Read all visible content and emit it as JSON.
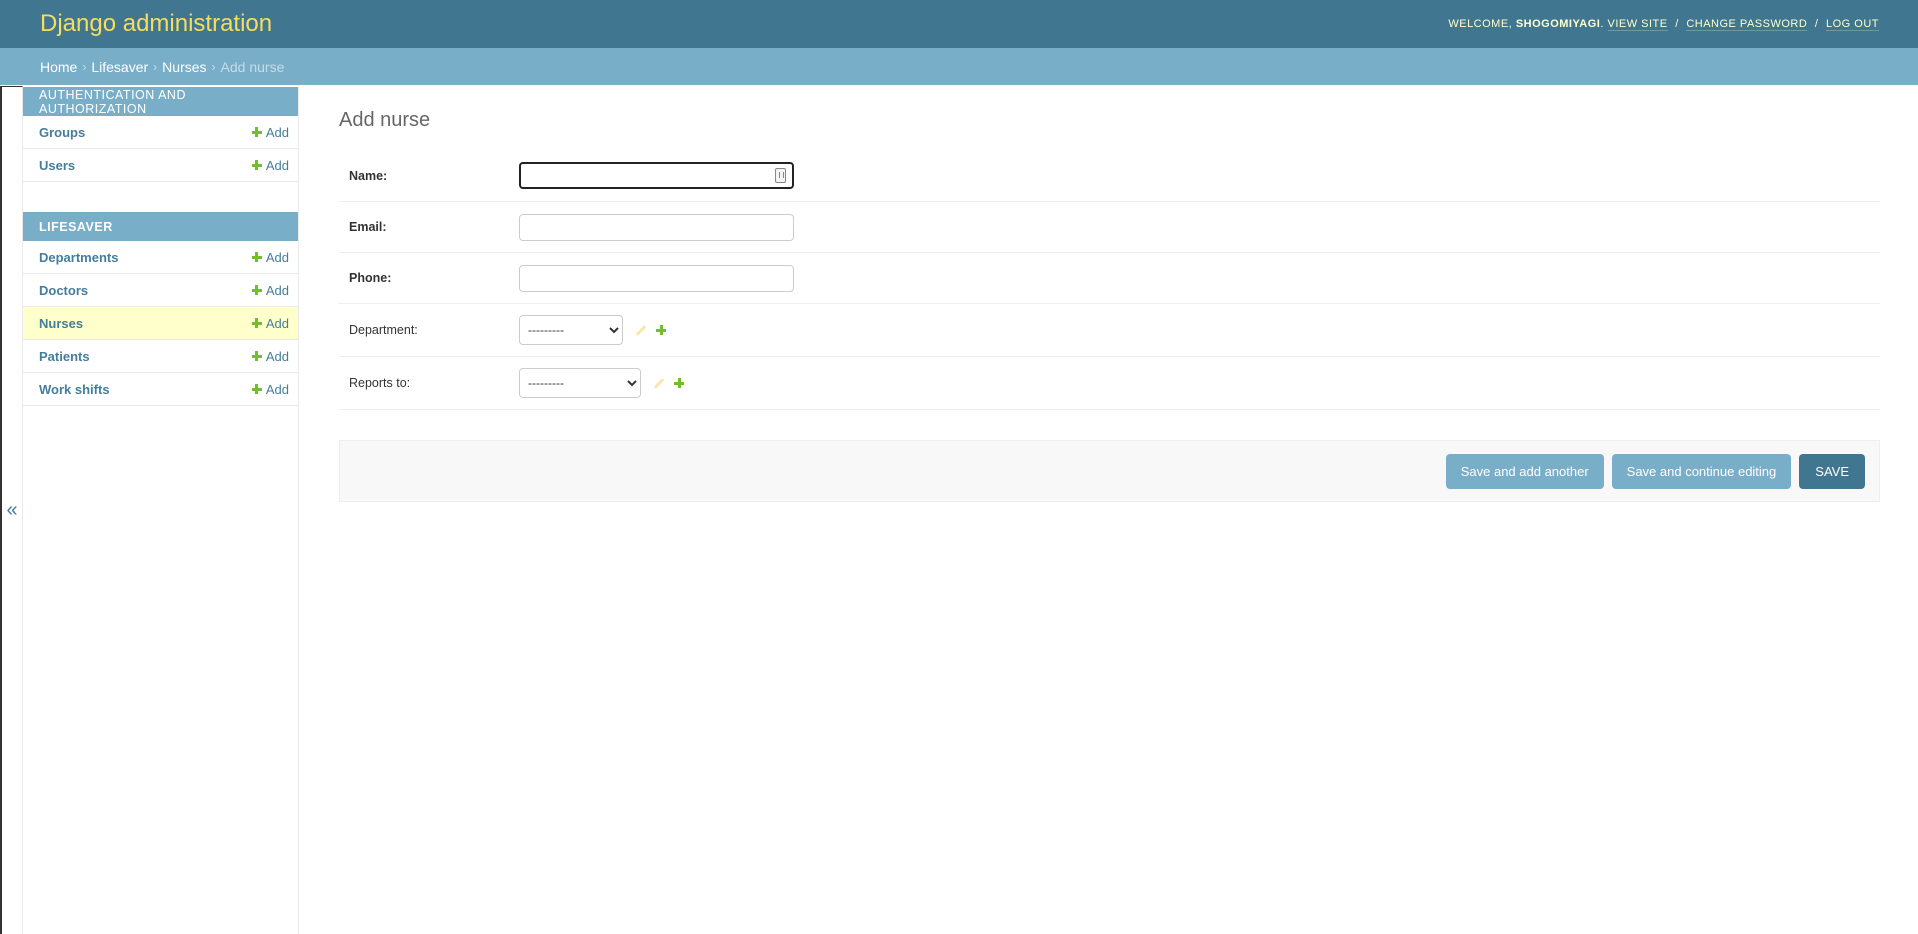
{
  "header": {
    "branding": "Django administration",
    "welcome": "WELCOME,",
    "user_name": "SHOGOMIYAGI",
    "view_site": "VIEW SITE",
    "change_password": "CHANGE PASSWORD",
    "log_out": "LOG OUT",
    "separator": "/"
  },
  "breadcrumbs": {
    "home": "Home",
    "app": "Lifesaver",
    "model": "Nurses",
    "current": "Add nurse",
    "arrow": "›"
  },
  "sidebar": {
    "toggle": "«",
    "modules": [
      {
        "caption": "AUTHENTICATION AND AUTHORIZATION",
        "models": [
          {
            "name": "Groups",
            "add": "Add"
          },
          {
            "name": "Users",
            "add": "Add"
          }
        ]
      },
      {
        "caption": "LIFESAVER",
        "models": [
          {
            "name": "Departments",
            "add": "Add"
          },
          {
            "name": "Doctors",
            "add": "Add"
          },
          {
            "name": "Nurses",
            "add": "Add",
            "current": true
          },
          {
            "name": "Patients",
            "add": "Add"
          },
          {
            "name": "Work shifts",
            "add": "Add"
          }
        ]
      }
    ]
  },
  "form": {
    "title": "Add nurse",
    "fields": {
      "name": {
        "label": "Name:",
        "value": ""
      },
      "email": {
        "label": "Email:",
        "value": ""
      },
      "phone": {
        "label": "Phone:",
        "value": ""
      },
      "department": {
        "label": "Department:",
        "selected": "---------"
      },
      "reports_to": {
        "label": "Reports to:",
        "selected": "---------"
      }
    }
  },
  "submit": {
    "save_add_another": "Save and add another",
    "save_continue": "Save and continue editing",
    "save": "SAVE"
  },
  "colors": {
    "header_bg": "#417690",
    "breadcrumb_bg": "#79aec8",
    "branding": "#f5dd5d",
    "link": "#447e9b",
    "add_plus": "#70bf2b",
    "current_row": "#ffffcc"
  }
}
